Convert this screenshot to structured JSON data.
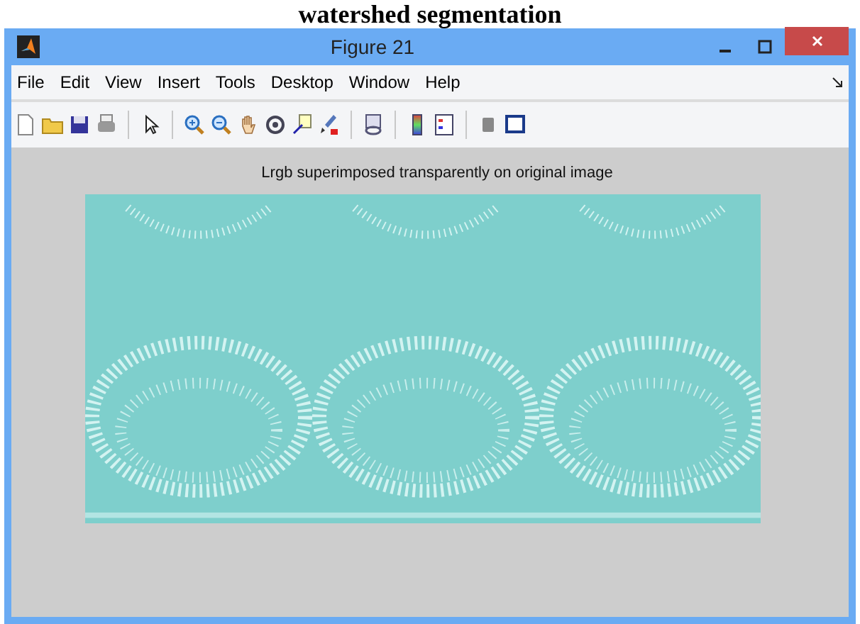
{
  "caption": "watershed segmentation",
  "window": {
    "title": "Figure 21"
  },
  "menu": [
    {
      "label": "File"
    },
    {
      "label": "Edit"
    },
    {
      "label": "View"
    },
    {
      "label": "Insert"
    },
    {
      "label": "Tools"
    },
    {
      "label": "Desktop"
    },
    {
      "label": "Window"
    },
    {
      "label": "Help"
    }
  ],
  "toolbar": [
    {
      "kind": "new"
    },
    {
      "kind": "open"
    },
    {
      "kind": "save"
    },
    {
      "kind": "print"
    },
    {
      "kind": "sep"
    },
    {
      "kind": "pointer"
    },
    {
      "kind": "sep"
    },
    {
      "kind": "zoomin"
    },
    {
      "kind": "zoomout"
    },
    {
      "kind": "pan"
    },
    {
      "kind": "rotate"
    },
    {
      "kind": "datacursor"
    },
    {
      "kind": "brush"
    },
    {
      "kind": "sep"
    },
    {
      "kind": "link"
    },
    {
      "kind": "sep"
    },
    {
      "kind": "colorbar"
    },
    {
      "kind": "legend"
    },
    {
      "kind": "sep"
    },
    {
      "kind": "hide"
    },
    {
      "kind": "dock"
    }
  ],
  "axes": {
    "title": "Lrgb superimposed transparently on original image"
  }
}
